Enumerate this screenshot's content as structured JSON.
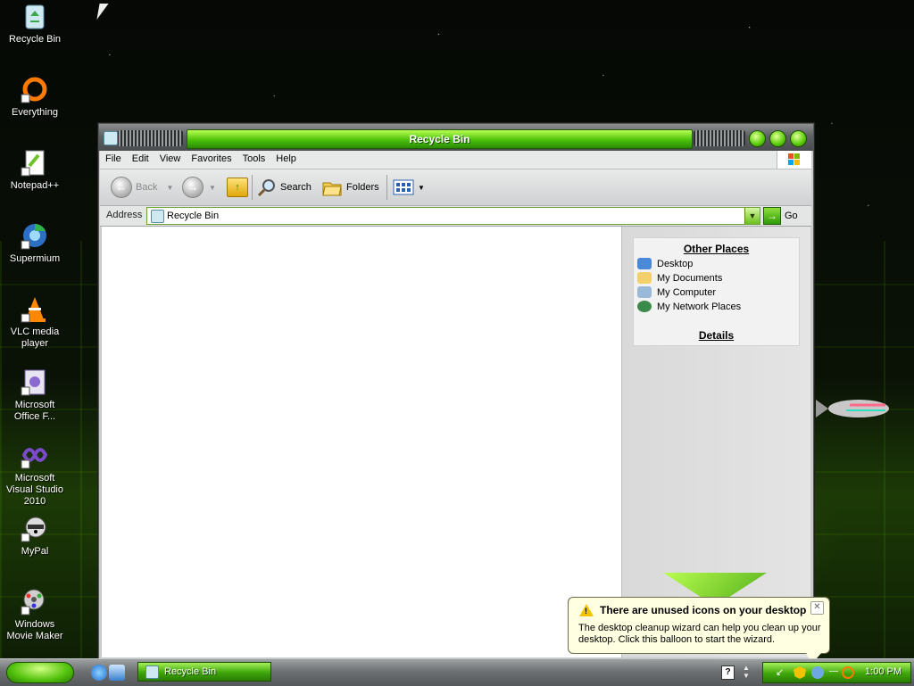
{
  "desktop": {
    "icons": [
      {
        "label": "Recycle Bin"
      },
      {
        "label": "Everything"
      },
      {
        "label": "Notepad++"
      },
      {
        "label": "Supermium"
      },
      {
        "label": "VLC media player"
      },
      {
        "label": "Microsoft Office F..."
      },
      {
        "label": "Microsoft Visual Studio 2010"
      },
      {
        "label": "MyPal"
      },
      {
        "label": "Windows Movie Maker"
      }
    ]
  },
  "window": {
    "title": "Recycle Bin",
    "menu": [
      "File",
      "Edit",
      "View",
      "Favorites",
      "Tools",
      "Help"
    ],
    "toolbar": {
      "back_label": "Back",
      "search_label": "Search",
      "folders_label": "Folders"
    },
    "address": {
      "label": "Address",
      "value": "Recycle Bin",
      "go_label": "Go"
    },
    "side_panel": {
      "other_places_title": "Other Places",
      "places": [
        "Desktop",
        "My Documents",
        "My Computer",
        "My Network Places"
      ],
      "details_title": "Details"
    }
  },
  "balloon": {
    "title": "There are unused icons on your desktop",
    "text": "The desktop cleanup wizard can help you clean up your desktop. Click this balloon to start the wizard."
  },
  "taskbar": {
    "task_label": "Recycle Bin",
    "clock": "1:00 PM",
    "help_glyph": "?"
  },
  "colors": {
    "accent_green": "#4bc10b",
    "balloon_bg": "#ffffe1"
  }
}
